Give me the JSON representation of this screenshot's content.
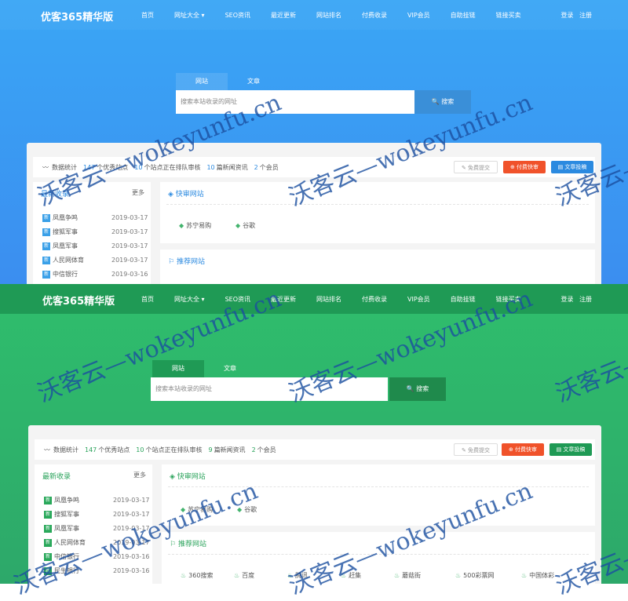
{
  "site_a": {
    "brand": "优客365精华版",
    "nav": [
      "首页",
      "网址大全 ▾",
      "SEO资讯",
      "最近更新",
      "网站排名",
      "付费收录",
      "VIP会员",
      "自助挂链",
      "链接买卖"
    ],
    "login": "登录",
    "register": "注册",
    "tab_site": "网站",
    "tab_article": "文章",
    "search_placeholder": "搜索本站收录的网址",
    "search_button": "搜索",
    "stats_label": "数据统计",
    "stats": {
      "sites": "147",
      "sites_label": "个优秀站点",
      "pending": "10",
      "pending_label": "个站点正在排队审核",
      "news": "10",
      "news_label": "篇新闻资讯",
      "members": "2",
      "members_label": "个会员"
    },
    "free_submit": "免费提交",
    "paid_review": "付费快审",
    "article_submit": "文章投稿",
    "latest_title": "最新收录",
    "more": "更多",
    "latest": [
      {
        "tag": "新",
        "name": "凤凰争鸣",
        "date": "2019-03-17"
      },
      {
        "tag": "新",
        "name": "搜狐军事",
        "date": "2019-03-17"
      },
      {
        "tag": "新",
        "name": "凤凰军事",
        "date": "2019-03-17"
      },
      {
        "tag": "新",
        "name": "人民网体育",
        "date": "2019-03-17"
      },
      {
        "tag": "新",
        "name": "中信银行",
        "date": "2019-03-16"
      }
    ],
    "fast_title": "快审网站",
    "fast_sites": [
      "苏宁易购",
      "谷歌"
    ],
    "rec_title": "推荐网站"
  },
  "site_b": {
    "brand": "优客365精华版",
    "nav": [
      "首页",
      "网址大全 ▾",
      "SEO资讯",
      "最近更新",
      "网站排名",
      "付费收录",
      "VIP会员",
      "自助挂链",
      "链接买卖"
    ],
    "login": "登录",
    "register": "注册",
    "tab_site": "网站",
    "tab_article": "文章",
    "search_placeholder": "搜索本站收录的网址",
    "search_button": "搜索",
    "stats_label": "数据统计",
    "stats": {
      "sites": "147",
      "sites_label": "个优秀站点",
      "pending": "10",
      "pending_label": "个站点正在排队审核",
      "news": "9",
      "news_label": "篇新闻资讯",
      "members": "2",
      "members_label": "个会员"
    },
    "free_submit": "免费提交",
    "paid_review": "付费快审",
    "article_submit": "文章投稿",
    "latest_title": "最新收录",
    "more": "更多",
    "latest": [
      {
        "tag": "新",
        "name": "凤凰争鸣",
        "date": "2019-03-17"
      },
      {
        "tag": "新",
        "name": "搜狐军事",
        "date": "2019-03-17"
      },
      {
        "tag": "新",
        "name": "凤凰军事",
        "date": "2019-03-17"
      },
      {
        "tag": "新",
        "name": "人民网体育",
        "date": "2019-03-17"
      },
      {
        "tag": "新",
        "name": "中信银行",
        "date": "2019-03-16"
      },
      {
        "tag": "新",
        "name": "民生银行",
        "date": "2019-03-16"
      }
    ],
    "fast_title": "快审网站",
    "fast_sites": [
      "苏宁易购",
      "谷歌"
    ],
    "rec_title": "推荐网站",
    "rec_sites": [
      "360搜索",
      "百度",
      "腾讯",
      "赶集",
      "蘑菇街",
      "500彩票网",
      "中国体彩"
    ]
  },
  "watermark": "沃客云—wokeyunfu.cn",
  "colors": {
    "blue_theme": "#3b9af2",
    "green_theme": "#2fb56a",
    "paid_button": "#f0522a",
    "article_button_blue": "#2b8ae0",
    "article_button_green": "#1f9a55",
    "new_tag_blue": "#3aa0e8",
    "new_tag_green": "#29a85a"
  }
}
